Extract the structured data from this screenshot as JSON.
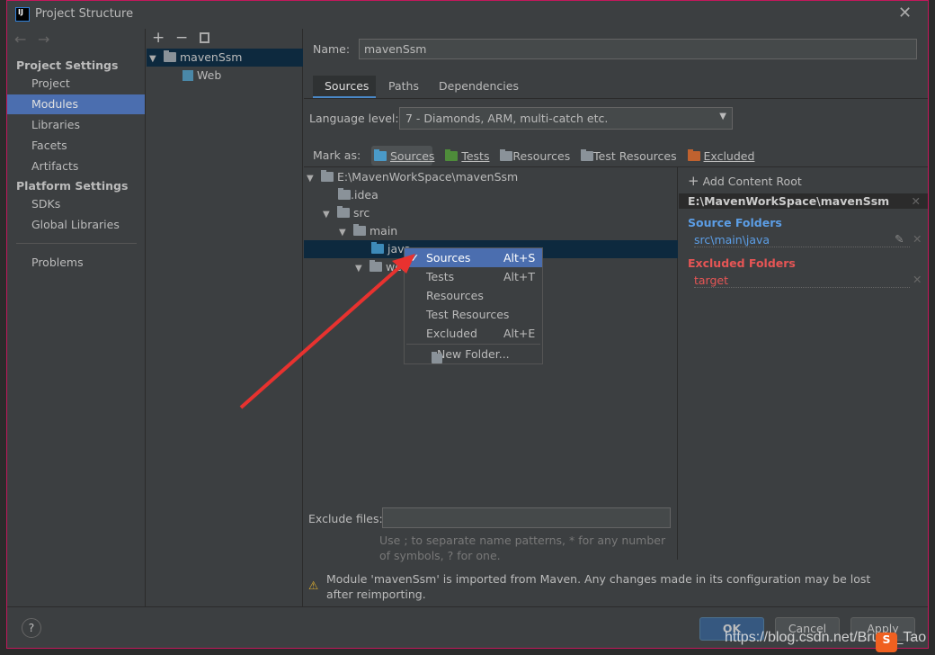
{
  "window": {
    "title": "Project Structure",
    "app_icon": "IJ"
  },
  "sidebar": {
    "section1": "Project Settings",
    "items1": [
      "Project",
      "Modules",
      "Libraries",
      "Facets",
      "Artifacts"
    ],
    "section2": "Platform Settings",
    "items2": [
      "SDKs",
      "Global Libraries"
    ],
    "problems": "Problems",
    "selected": "Modules"
  },
  "module_tree": {
    "root": "mavenSsm",
    "child": "Web"
  },
  "main": {
    "name_label": "Name:",
    "name_value": "mavenSsm",
    "tabs": [
      "Sources",
      "Paths",
      "Dependencies"
    ],
    "language_label": "Language level:",
    "language_value": "7 - Diamonds, ARM, multi-catch etc.",
    "mark_as_label": "Mark as:",
    "mark_as": [
      "Sources",
      "Tests",
      "Resources",
      "Test Resources",
      "Excluded"
    ],
    "tree": {
      "root": "E:\\MavenWorkSpace\\mavenSsm",
      "idea": ".idea",
      "src": "src",
      "main": "main",
      "java": "java",
      "web": "webapp"
    },
    "exclude_label": "Exclude files:",
    "exclude_value": "",
    "exclude_hint": "Use ; to separate name patterns, * for any number of symbols, ? for one.",
    "warning": "Module 'mavenSsm' is imported from Maven. Any changes made in its configuration may be lost after reimporting."
  },
  "content_root": {
    "add_label": "Add Content Root",
    "path": "E:\\MavenWorkSpace\\mavenSsm",
    "source_header": "Source Folders",
    "source_item": "src\\main\\java",
    "excluded_header": "Excluded Folders",
    "excluded_item": "target"
  },
  "context_menu": {
    "items": [
      {
        "label": "Sources",
        "shortcut": "Alt+S",
        "checked": true
      },
      {
        "label": "Tests",
        "shortcut": "Alt+T"
      },
      {
        "label": "Resources",
        "shortcut": ""
      },
      {
        "label": "Test Resources",
        "shortcut": ""
      },
      {
        "label": "Excluded",
        "shortcut": "Alt+E"
      }
    ],
    "new_folder": "New Folder..."
  },
  "footer": {
    "help": "?",
    "ok": "OK",
    "cancel": "Cancel",
    "apply": "Apply"
  },
  "watermark": "https://blog.csdn.net/Bruce_Tao",
  "colors": {
    "accent": "#4b6eaf",
    "source": "#5c9ee6",
    "excluded": "#e65555",
    "selection": "#0d293e"
  }
}
